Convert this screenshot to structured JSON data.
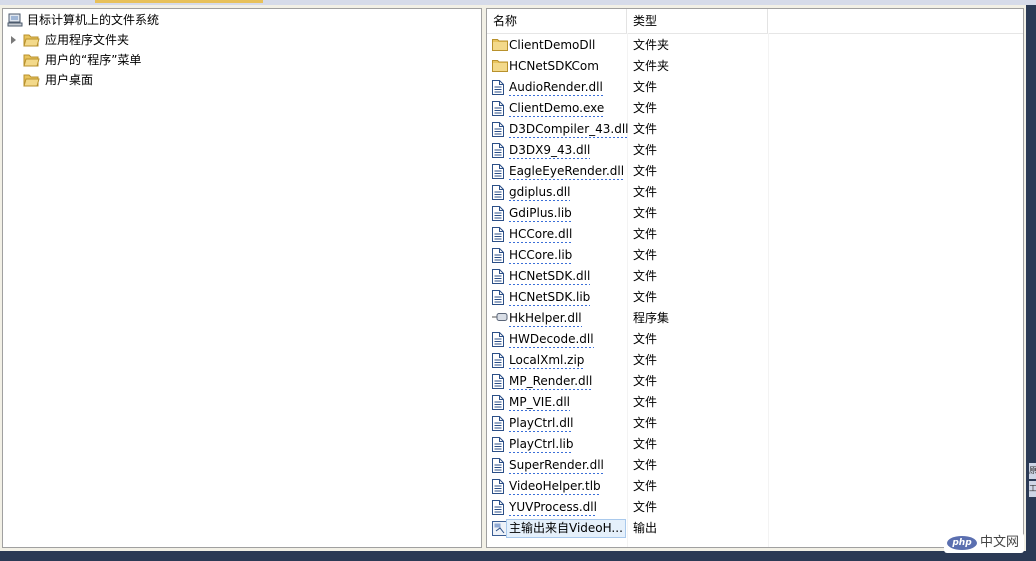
{
  "tree": {
    "root": {
      "label": "目标计算机上的文件系统",
      "icon": "computer-icon"
    },
    "items": [
      {
        "label": "应用程序文件夹",
        "icon": "folder-icon",
        "expandable": true
      },
      {
        "label": "用户的“程序”菜单",
        "icon": "folder-icon",
        "expandable": false
      },
      {
        "label": "用户桌面",
        "icon": "folder-icon",
        "expandable": false
      }
    ]
  },
  "columns": {
    "name": "名称",
    "type": "类型"
  },
  "files": [
    {
      "name": "ClientDemoDll",
      "type": "文件夹",
      "icon": "folder-icon",
      "squiggle": false,
      "selected": false
    },
    {
      "name": "HCNetSDKCom",
      "type": "文件夹",
      "icon": "folder-icon",
      "squiggle": false,
      "selected": false
    },
    {
      "name": "AudioRender.dll",
      "type": "文件",
      "icon": "file-icon",
      "squiggle": true,
      "selected": false
    },
    {
      "name": "ClientDemo.exe",
      "type": "文件",
      "icon": "file-icon",
      "squiggle": true,
      "selected": false
    },
    {
      "name": "D3DCompiler_43.dll",
      "type": "文件",
      "icon": "file-icon",
      "squiggle": true,
      "selected": false
    },
    {
      "name": "D3DX9_43.dll",
      "type": "文件",
      "icon": "file-icon",
      "squiggle": true,
      "selected": false
    },
    {
      "name": "EagleEyeRender.dll",
      "type": "文件",
      "icon": "file-icon",
      "squiggle": true,
      "selected": false
    },
    {
      "name": "gdiplus.dll",
      "type": "文件",
      "icon": "file-icon",
      "squiggle": true,
      "selected": false
    },
    {
      "name": "GdiPlus.lib",
      "type": "文件",
      "icon": "file-icon",
      "squiggle": true,
      "selected": false
    },
    {
      "name": "HCCore.dll",
      "type": "文件",
      "icon": "file-icon",
      "squiggle": true,
      "selected": false
    },
    {
      "name": "HCCore.lib",
      "type": "文件",
      "icon": "file-icon",
      "squiggle": true,
      "selected": false
    },
    {
      "name": "HCNetSDK.dll",
      "type": "文件",
      "icon": "file-icon",
      "squiggle": true,
      "selected": false
    },
    {
      "name": "HCNetSDK.lib",
      "type": "文件",
      "icon": "file-icon",
      "squiggle": true,
      "selected": false
    },
    {
      "name": "HkHelper.dll",
      "type": "程序集",
      "icon": "assembly-icon",
      "squiggle": true,
      "selected": false
    },
    {
      "name": "HWDecode.dll",
      "type": "文件",
      "icon": "file-icon",
      "squiggle": true,
      "selected": false
    },
    {
      "name": "LocalXml.zip",
      "type": "文件",
      "icon": "file-icon",
      "squiggle": true,
      "selected": false
    },
    {
      "name": "MP_Render.dll",
      "type": "文件",
      "icon": "file-icon",
      "squiggle": true,
      "selected": false
    },
    {
      "name": "MP_VIE.dll",
      "type": "文件",
      "icon": "file-icon",
      "squiggle": true,
      "selected": false
    },
    {
      "name": "PlayCtrl.dll",
      "type": "文件",
      "icon": "file-icon",
      "squiggle": true,
      "selected": false
    },
    {
      "name": "PlayCtrl.lib",
      "type": "文件",
      "icon": "file-icon",
      "squiggle": true,
      "selected": false
    },
    {
      "name": "SuperRender.dll",
      "type": "文件",
      "icon": "file-icon",
      "squiggle": true,
      "selected": false
    },
    {
      "name": "VideoHelper.tlb",
      "type": "文件",
      "icon": "file-icon",
      "squiggle": true,
      "selected": false
    },
    {
      "name": "YUVProcess.dll",
      "type": "文件",
      "icon": "file-icon",
      "squiggle": true,
      "selected": false
    },
    {
      "name": "主输出来自VideoH...",
      "type": "输出",
      "icon": "output-icon",
      "squiggle": false,
      "selected": true
    }
  ],
  "right_edge_tabs": [
    "原",
    "工"
  ],
  "watermark": {
    "logo": "php",
    "text": "中文网"
  },
  "colors": {
    "background": "#2b3a55",
    "frame": "#f2f0e6",
    "panel": "#ffffff",
    "squiggle": "#3a6fd8",
    "selection": "#e5f0fb",
    "folder": "#e8c45e"
  }
}
